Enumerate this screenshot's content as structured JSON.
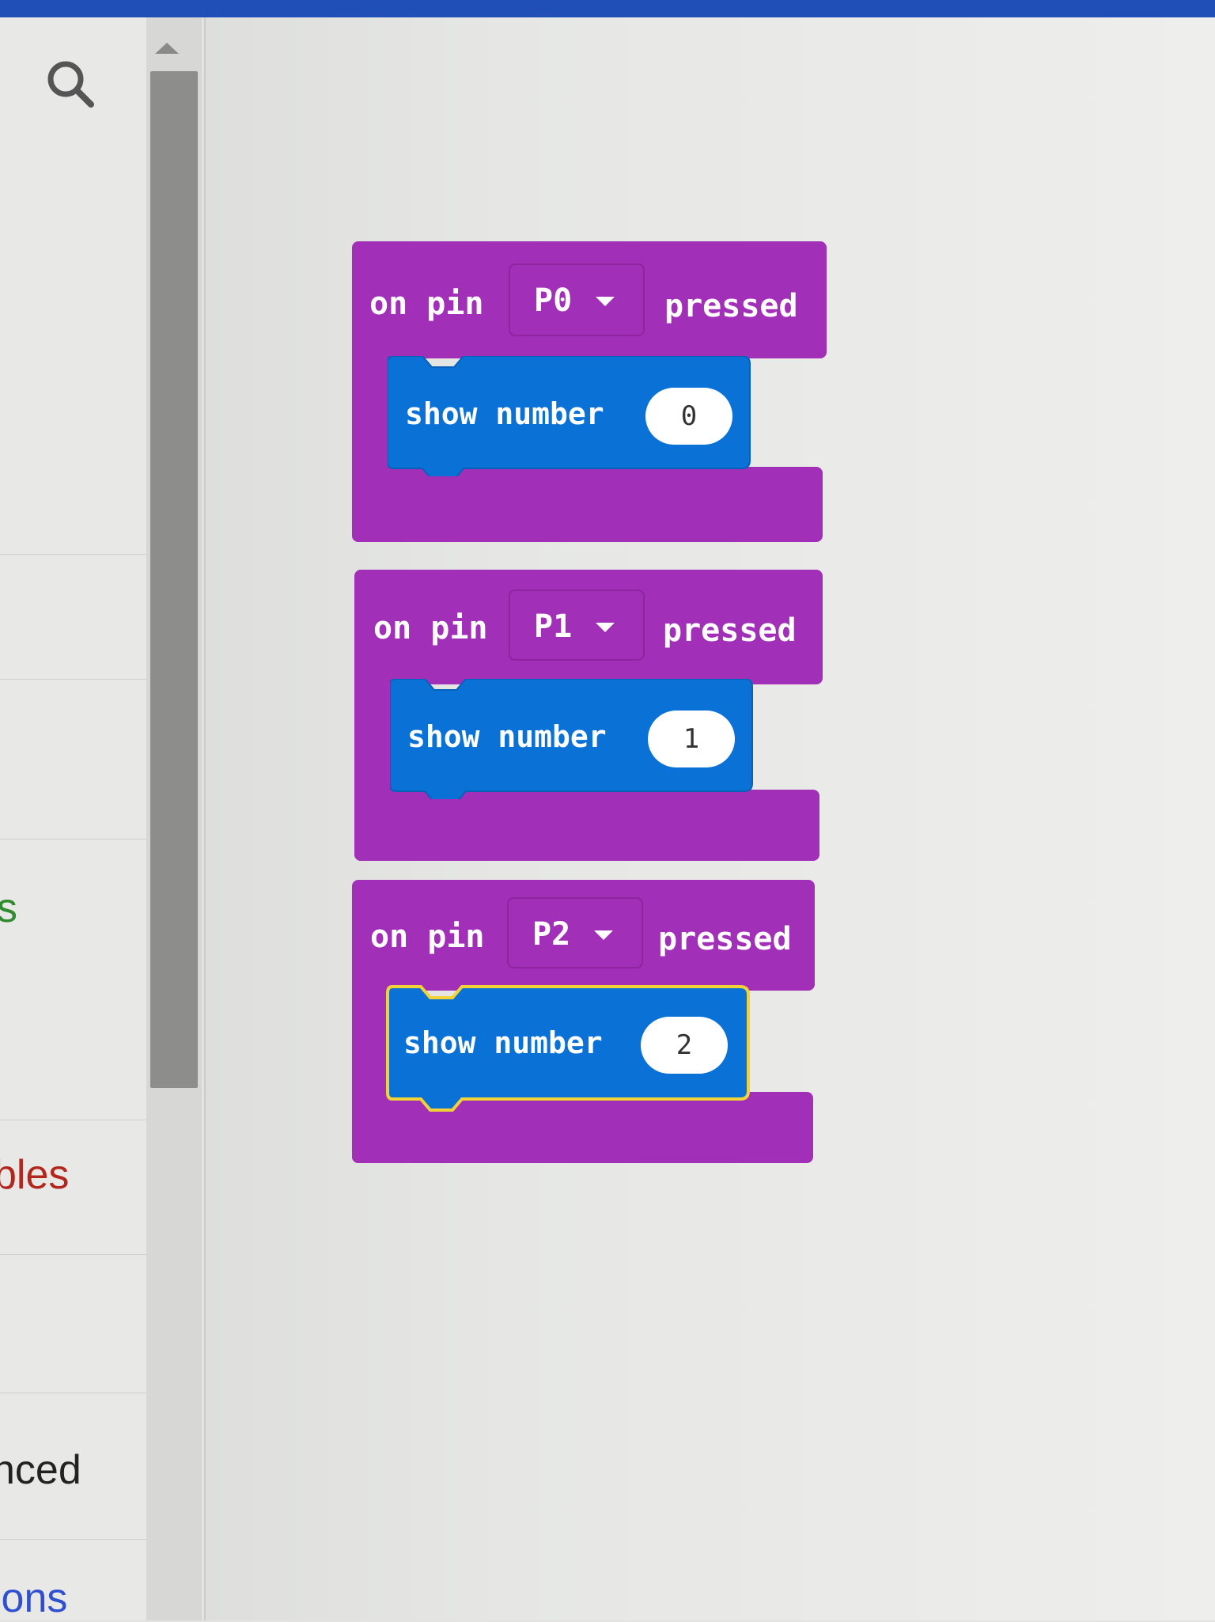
{
  "sidebar": {
    "search_icon": "search-icon",
    "categories": [
      {
        "label": "s",
        "color": "#2e8b2e"
      },
      {
        "label": "bles",
        "color": "#b3261e"
      },
      {
        "label": "nced",
        "color": "#222222"
      },
      {
        "label": "ions",
        "color": "#2f4fd0"
      }
    ]
  },
  "workspace": {
    "blocks": [
      {
        "on_label": "on pin",
        "pin": "P0",
        "pressed_label": "pressed",
        "show_label": "show number",
        "value": "0"
      },
      {
        "on_label": "on pin",
        "pin": "P1",
        "pressed_label": "pressed",
        "show_label": "show number",
        "value": "1"
      },
      {
        "on_label": "on pin",
        "pin": "P2",
        "pressed_label": "pressed",
        "show_label": "show number",
        "value": "2"
      }
    ]
  },
  "colors": {
    "event_block": "#a22fb7",
    "show_block": "#0a72d6",
    "selected_outline": "#f2d335",
    "top_bar": "#1f4fb7"
  }
}
